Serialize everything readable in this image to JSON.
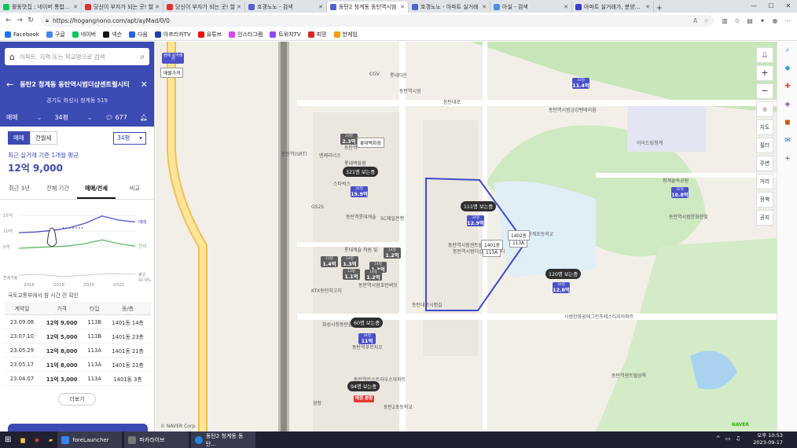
{
  "browser": {
    "tabs": [
      {
        "label": "활동맛집 : 네이버 통합검색",
        "color": "#03c75a"
      },
      {
        "label": "당신이 부자가 되는 곳! 할",
        "color": "#e03131"
      },
      {
        "label": "당신이 부자가 되는 곳! 할",
        "color": "#e03131"
      },
      {
        "label": "호갱노노 - 검색",
        "color": "#5161d6"
      },
      {
        "label": "동탄2 청계동 동탄역시범",
        "color": "#5161d6",
        "active": true
      },
      {
        "label": "호갱노노 - 아파트 실거래",
        "color": "#5161d6"
      },
      {
        "label": "아실 - 검색",
        "color": "#4a90e2"
      },
      {
        "label": "아파트 실거래가, 분양정보",
        "color": "#3c3ccf"
      }
    ],
    "new_tab": "+",
    "url": "https://hogangnono.com/apt/ayMad/0/0",
    "bookmarks": [
      "Facebook",
      "구글",
      "네이버",
      "넥슨",
      "다음",
      "아프리카TV",
      "유튜브",
      "인스타그램",
      "트위치TV",
      "피망",
      "한게임"
    ]
  },
  "panel": {
    "search_placeholder": "아파트, 지역 또는 학교명으로 검색",
    "title": "동탄2 청계동 동탄역시범더샵센트럴시티",
    "address": "경기도 화성시 청계동 519",
    "deal_type": "매매",
    "size_select": "34평",
    "comments": "677",
    "pill_trade": "매매",
    "pill_rent": "전월세",
    "pyeong_button": "34평",
    "latest_label": "최근 실거래 기준 1개월 평균",
    "latest_price": "12억 9,000",
    "subtabs": [
      "최근 3년",
      "전체 기간",
      "매매/전세",
      "비교"
    ],
    "active_subtab": 2,
    "chart_labels": {
      "y_top": "15억",
      "y_mid": "10억",
      "y_low": "5억",
      "y_rate": "전세가율",
      "legend_trade": "매매",
      "legend_rent": "전세",
      "legend_rate": "41.9%",
      "rate_label": "평균",
      "x": [
        "2016",
        "2018",
        "2020",
        "2022"
      ]
    },
    "data_note": "국토교통부에서 참 시간 전 확인",
    "table_headers": [
      "계약일",
      "가격",
      "타입",
      "동/층"
    ],
    "table_rows": [
      [
        "23.09.08",
        "12억 9,000",
        "113B",
        "1401동 14층"
      ],
      [
        "23.07.10",
        "12억 5,000",
        "113B",
        "1401동 23층"
      ],
      [
        "23.05.29",
        "12억 8,000",
        "113A",
        "1401동 21층"
      ],
      [
        "23.05.17",
        "11억 8,000",
        "113A",
        "1401동 21층"
      ],
      [
        "23.04.07",
        "11억 3,000",
        "113A",
        "1401동 3층"
      ]
    ],
    "more_button": "더보기"
  },
  "chart_data": {
    "type": "line",
    "x": [
      "2016",
      "2017",
      "2018",
      "2019",
      "2020",
      "2021",
      "2022",
      "2023"
    ],
    "series": [
      {
        "name": "매매",
        "values": [
          9.5,
          9.7,
          10.2,
          11.0,
          12.5,
          14.8,
          13.5,
          12.9
        ]
      },
      {
        "name": "전세",
        "values": [
          4.5,
          4.8,
          5.0,
          5.3,
          6.0,
          7.2,
          6.0,
          5.2
        ]
      }
    ],
    "ylim": [
      0,
      16
    ]
  },
  "map": {
    "labels": [
      "롯데타운",
      "CGV",
      "동탄역시범",
      "동탄역",
      "롯데백화점",
      "엔제리너스",
      "스타벅스",
      "GS25",
      "동탄역롯데캐슬",
      "SC제일은행",
      "KTX동탄차고지",
      "동탄역시범센트럴자이",
      "동탄역시범더샵센트럴시티",
      "화성청계초등학교",
      "아이드림청계",
      "청계숲속공원",
      "롯데캐슬 직원 및",
      "동탄대로시범길",
      "120명 보는중",
      "동탄역시범금강펜테리움",
      "시범한화꿈에그린프레스티지아파트",
      "동탄역시범한화한빛",
      "화성시청동탄출장소",
      "동탄역시범호반써밋",
      "동탄역린스트라우스아파트",
      "동탄역푸르지오",
      "광장",
      "동탄역센트럴상록",
      "동탄2초등학교",
      "© NAVER Corp.",
      "NAVER",
      "동탄역(SRT)",
      "동탄대로"
    ],
    "markers": [
      {
        "top": "20평",
        "val": "2.3억",
        "color": "gray"
      },
      {
        "top": "34평",
        "val": "15.9억",
        "color": "blue"
      },
      {
        "top": "34평",
        "val": "12.9억",
        "color": "blue"
      },
      {
        "top": "33평",
        "val": "11.4억",
        "color": "blue"
      },
      {
        "top": "32평",
        "val": "10.8억",
        "color": "blue"
      },
      {
        "top": "34평",
        "val": "12.8억",
        "color": "blue"
      },
      {
        "top": "34평",
        "val": "11억",
        "color": "blue"
      },
      {
        "top": "11평",
        "val": "1.4억",
        "color": "gray"
      },
      {
        "top": "14평",
        "val": "1.3억",
        "color": "gray"
      },
      {
        "top": "14평",
        "val": "1.3억",
        "color": "gray"
      },
      {
        "top": "14평",
        "val": "1.2억",
        "color": "gray"
      },
      {
        "top": "13평",
        "val": "1.1억",
        "color": "gray"
      },
      {
        "top": "14평",
        "val": "1.2억",
        "color": "gray"
      }
    ],
    "viewers": [
      "321명 보는중",
      "111명 보는중",
      "120명 보는중",
      "60명 보는중",
      "94명 보는중"
    ],
    "tags": [
      "1401동",
      "1402동",
      "113A",
      "113A",
      "롯데백화점"
    ],
    "badge_hot": "현재 실거래가",
    "badge_hot2": "매물가격",
    "school": "예정 분양",
    "side_buttons": [
      "지도",
      "필터",
      "주변",
      "거리",
      "정책",
      "공지"
    ],
    "zoom_in": "+",
    "zoom_out": "−"
  },
  "taskbar": {
    "apps": [
      "foreLauncher",
      "파카라이브",
      "동탄2 청계동 동탄..."
    ],
    "time": "오후 10:53",
    "date": "2023-09-17"
  }
}
